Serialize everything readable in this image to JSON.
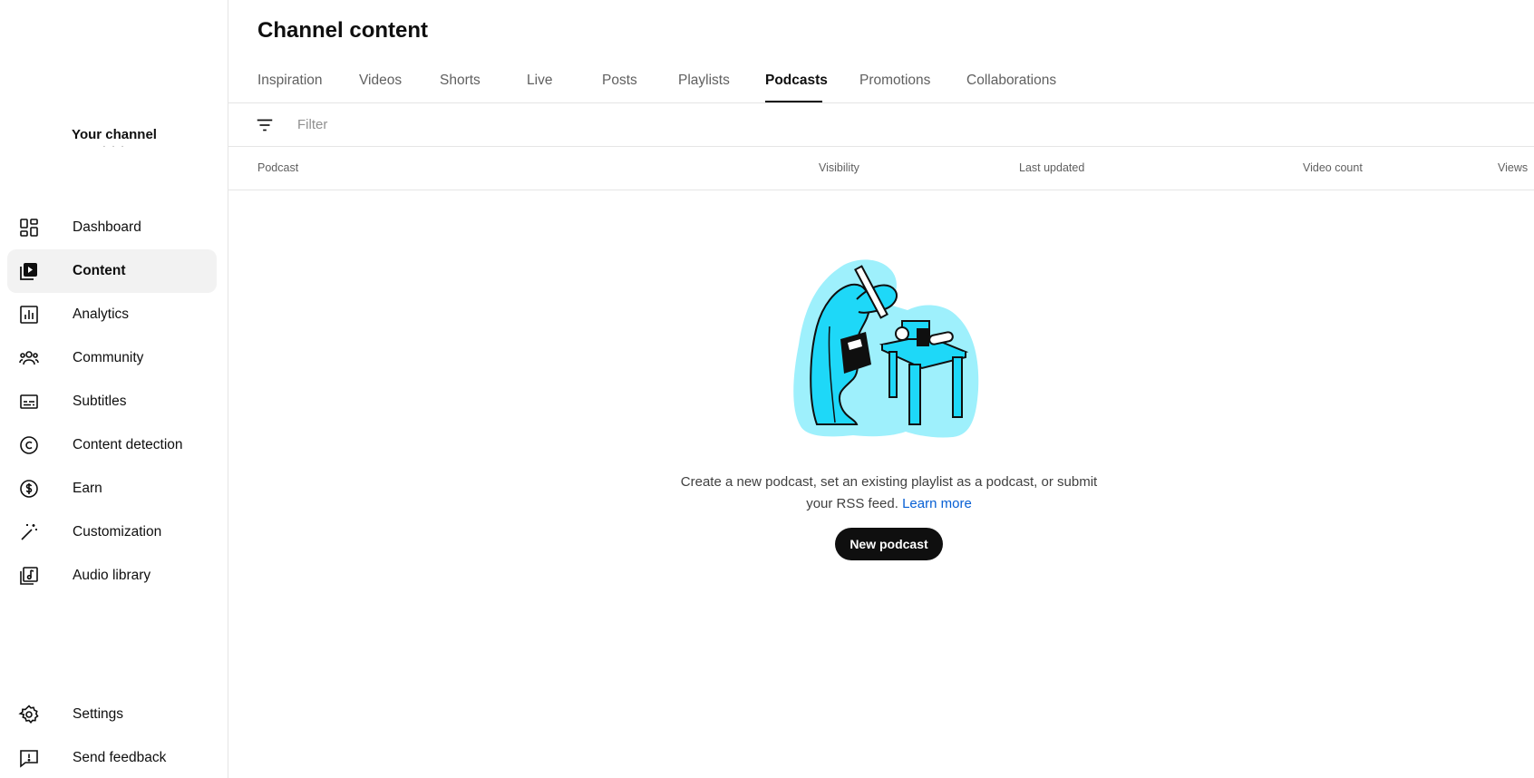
{
  "sidebar": {
    "channel_title": "Your channel",
    "channel_subtitle": "· · ·",
    "items": [
      {
        "label": "Dashboard",
        "icon": "dashboard-icon"
      },
      {
        "label": "Content",
        "icon": "content-icon",
        "active": true
      },
      {
        "label": "Analytics",
        "icon": "analytics-icon"
      },
      {
        "label": "Community",
        "icon": "community-icon"
      },
      {
        "label": "Subtitles",
        "icon": "subtitles-icon"
      },
      {
        "label": "Content detection",
        "icon": "copyright-icon"
      },
      {
        "label": "Earn",
        "icon": "dollar-icon"
      },
      {
        "label": "Customization",
        "icon": "magic-wand-icon"
      },
      {
        "label": "Audio library",
        "icon": "audio-library-icon"
      }
    ],
    "bottom_items": [
      {
        "label": "Settings",
        "icon": "gear-icon"
      },
      {
        "label": "Send feedback",
        "icon": "feedback-icon"
      }
    ]
  },
  "main": {
    "title": "Channel content",
    "tabs": [
      {
        "label": "Inspiration"
      },
      {
        "label": "Videos"
      },
      {
        "label": "Shorts"
      },
      {
        "label": "Live"
      },
      {
        "label": "Posts"
      },
      {
        "label": "Playlists"
      },
      {
        "label": "Podcasts",
        "active": true
      },
      {
        "label": "Promotions"
      },
      {
        "label": "Collaborations"
      }
    ],
    "filter": {
      "placeholder": "Filter",
      "value": ""
    },
    "columns": [
      "Podcast",
      "Visibility",
      "Last updated",
      "Video count",
      "Views"
    ],
    "empty_state": {
      "text": "Create a new podcast, set an existing playlist as a podcast, or submit your RSS feed.",
      "link": "Learn more",
      "button": "New podcast"
    }
  },
  "colors": {
    "accent": "#0f0f0f",
    "link": "#065fd4",
    "illustration_blue": "#1ed8f8",
    "illustration_light": "#9ef0fc"
  }
}
